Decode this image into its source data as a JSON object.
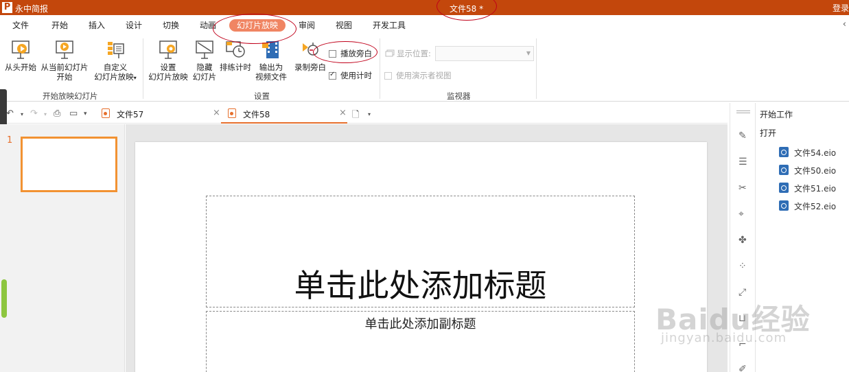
{
  "titlebar": {
    "app_logo": "P",
    "app_name": "永中简报",
    "doc_title": "文件58 *",
    "login": "登录"
  },
  "menu": {
    "tabs": [
      "文件",
      "开始",
      "插入",
      "设计",
      "切换",
      "动画",
      "幻灯片放映",
      "审阅",
      "视图",
      "开发工具"
    ],
    "active": "幻灯片放映"
  },
  "ribbon": {
    "start_group": {
      "from_start": "从头开始",
      "from_current_l1": "从当前幻灯片",
      "from_current_l2": "开始",
      "custom_l1": "自定义",
      "custom_l2": "幻灯片放映",
      "label": "开始放映幻灯片"
    },
    "setup_group": {
      "setup_l1": "设置",
      "setup_l2": "幻灯片放映",
      "hide_l1": "隐藏",
      "hide_l2": "幻灯片",
      "rehearse": "排练计时",
      "export_l1": "输出为",
      "export_l2": "视频文件",
      "record": "录制旁白",
      "play_narration": "播放旁白",
      "play_narration_checked": false,
      "use_timing": "使用计时",
      "use_timing_checked": true,
      "label": "设置"
    },
    "monitor_group": {
      "display_position": "显示位置:",
      "presenter_view": "使用演示者视图",
      "label": "监视器"
    }
  },
  "doc_tabs": [
    {
      "label": "文件57",
      "active": false
    },
    {
      "label": "文件58",
      "active": true
    }
  ],
  "slides": {
    "count_label": "1",
    "title_placeholder": "单击此处添加标题",
    "subtitle_placeholder": "单击此处添加副标题"
  },
  "right_panel": {
    "title": "开始工作",
    "open": "打开",
    "files": [
      "文件54.eio",
      "文件50.eio",
      "文件51.eio",
      "文件52.eio"
    ]
  },
  "watermark": {
    "main": "Baidu经验",
    "sub": "jingyan.baidu.com"
  },
  "colors": {
    "titlebar": "#c3470c",
    "active_tab": "#f08563",
    "accent": "#e66f2c",
    "annotation": "#c0001a"
  }
}
